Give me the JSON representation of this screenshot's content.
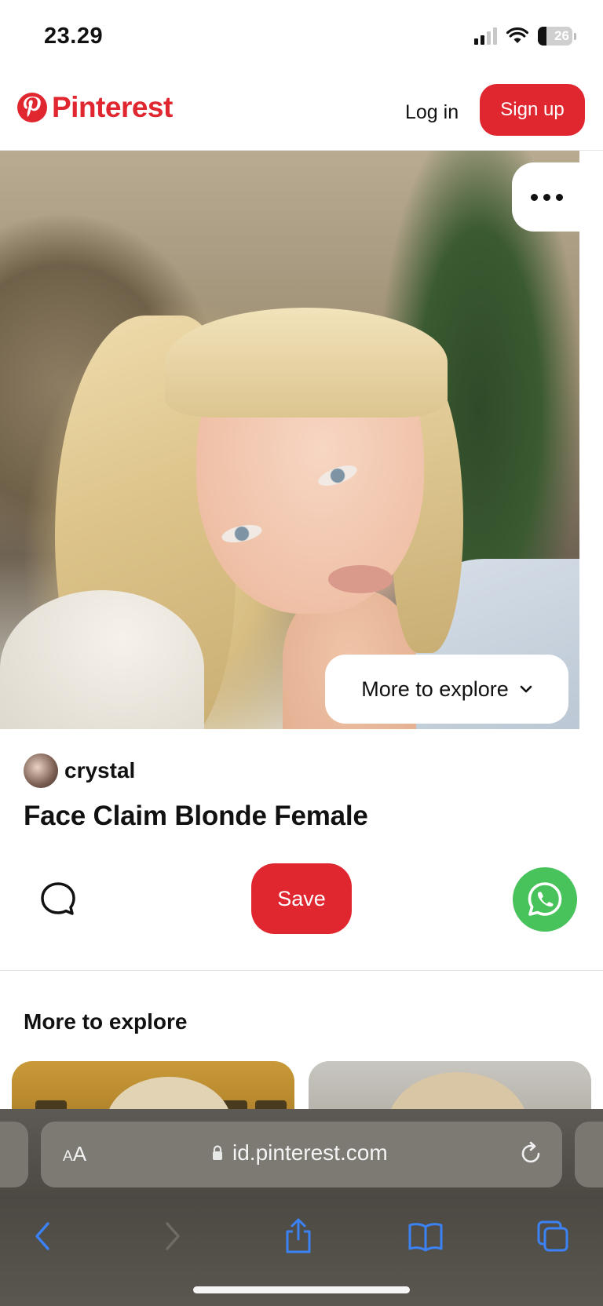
{
  "status_bar": {
    "time": "23.29",
    "battery_percent": "26",
    "battery_level": 0.26,
    "signal_bars": 2
  },
  "header": {
    "brand": "Pinterest",
    "login_label": "Log in",
    "signup_label": "Sign up",
    "brand_color": "#e0262f"
  },
  "pin": {
    "more_to_explore_button": "More to explore",
    "author": "crystal",
    "title": "Face Claim Blonde Female",
    "save_label": "Save"
  },
  "explore": {
    "heading": "More to explore"
  },
  "browser": {
    "text_size_label_small": "A",
    "text_size_label_large": "A",
    "url": "id.pinterest.com",
    "icons": [
      "lock-icon",
      "reload-icon",
      "back-icon",
      "forward-icon",
      "share-icon",
      "bookmarks-icon",
      "tabs-icon"
    ]
  }
}
